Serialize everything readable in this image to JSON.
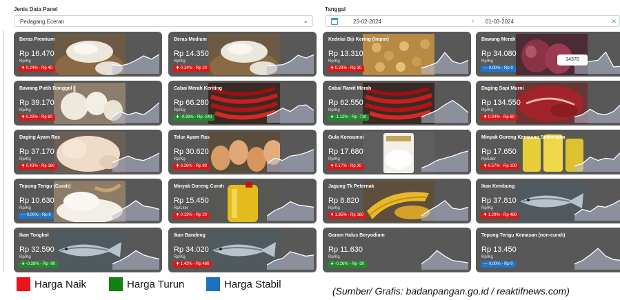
{
  "filters": {
    "panel_label": "Jenis Data Panel",
    "panel_value": "Pedagang Eceran",
    "date_label": "Tanggal",
    "date_from": "23-02-2024",
    "date_to": "01-03-2024"
  },
  "colors": {
    "card_bg": "#585858",
    "up": "#d81a1a",
    "down": "#1f8a2a",
    "flat": "#2275c7",
    "spark_fill": "#b8bdd6",
    "spark_line": "#ffffff"
  },
  "tooltip": {
    "value": "34370"
  },
  "items": [
    {
      "name": "Beras Premium",
      "price": "Rp 16.470",
      "unit": "Rp/Kg",
      "change": "0.24% - Rp 40",
      "trend": "up",
      "photo": "rice",
      "spark": [
        0.35,
        0.3,
        0.38,
        0.55,
        0.75,
        0.6,
        0.82
      ]
    },
    {
      "name": "Beras Medium",
      "price": "Rp 14.350",
      "unit": "Rp/Kg",
      "change": "0.14% - Rp 20",
      "trend": "up",
      "photo": "rice",
      "spark": [
        0.3,
        0.32,
        0.35,
        0.5,
        0.78,
        0.65,
        0.8
      ]
    },
    {
      "name": "Kedelai Biji Kering (Impor)",
      "price": "Rp 13.310",
      "unit": "Rp/Kg",
      "change": "0.23% - Rp 30",
      "trend": "up",
      "photo": "soy",
      "spark": [
        0.2,
        0.3,
        0.45,
        0.9,
        0.5,
        0.4,
        0.55
      ]
    },
    {
      "name": "Bawang Merah",
      "price": "Rp 34.080",
      "unit": "Rp/Kg",
      "change": "0.00% - Rp 0",
      "trend": "flat",
      "photo": "shallot",
      "spark": [
        0.3,
        0.4,
        0.5,
        0.55,
        0.92,
        0.25,
        0.28
      ]
    },
    {
      "name": "Bawang Putih Bonggol",
      "price": "Rp 39.170",
      "unit": "Rp/Kg",
      "change": "0.20% - Rp 80",
      "trend": "up",
      "photo": "garlic",
      "spark": [
        0.2,
        0.45,
        0.3,
        0.4,
        0.3,
        0.55,
        0.85
      ]
    },
    {
      "name": "Cabai Merah Keriting",
      "price": "Rp 66.280",
      "unit": "Rp/Kg",
      "change": "-0.36% - Rp -240",
      "trend": "down",
      "photo": "chili",
      "spark": [
        0.25,
        0.4,
        0.6,
        0.45,
        0.7,
        0.75,
        0.5
      ]
    },
    {
      "name": "Cabai Rawit Merah",
      "price": "Rp 62.550",
      "unit": "Rp/Kg",
      "change": "-1.12% - Rp -710",
      "trend": "down",
      "photo": "chili",
      "spark": [
        0.2,
        0.35,
        0.5,
        0.75,
        0.95,
        0.7,
        0.4
      ]
    },
    {
      "name": "Daging Sapi Murni",
      "price": "Rp 134.550",
      "unit": "Rp/Kg",
      "change": "0.04% - Rp 60",
      "trend": "up",
      "photo": "beef",
      "spark": [
        0.2,
        0.3,
        0.55,
        0.35,
        0.3,
        0.45,
        0.8
      ]
    },
    {
      "name": "Daging Ayam Ras",
      "price": "Rp 37.170",
      "unit": "Rp/Kg",
      "change": "0.43% - Rp 160",
      "trend": "up",
      "photo": "chicken",
      "spark": [
        0.35,
        0.5,
        0.65,
        0.5,
        0.45,
        0.6,
        0.78
      ]
    },
    {
      "name": "Telur Ayam Ras",
      "price": "Rp 30.620",
      "unit": "Rp/Kg",
      "change": "0.26% - Rp 80",
      "trend": "up",
      "photo": "egg",
      "spark": [
        0.3,
        0.55,
        0.45,
        0.65,
        0.7,
        0.8,
        0.95
      ]
    },
    {
      "name": "Gula Konsumsi",
      "price": "Rp 17.680",
      "unit": "Rp/Kg",
      "change": "0.17% - Rp 30",
      "trend": "up",
      "photo": "sugar",
      "spark": [
        0.1,
        0.25,
        0.45,
        0.55,
        0.65,
        0.78,
        0.88
      ]
    },
    {
      "name": "Minyak Goreng Kemasan Sederhana",
      "price": "Rp 17.650",
      "unit": "Rp/Liter",
      "change": "0.57% - Rp 100",
      "trend": "up",
      "photo": "oilbottle",
      "spark": [
        0.2,
        0.3,
        0.6,
        0.45,
        0.55,
        0.5,
        0.85
      ]
    },
    {
      "name": "Tepung Terigu (Curah)",
      "price": "Rp 10.630",
      "unit": "Rp/Kg",
      "change": "0.00% - Rp 0",
      "trend": "flat",
      "photo": "flour",
      "spark": [
        0.2,
        0.4,
        0.6,
        0.85,
        0.6,
        0.55,
        0.45
      ]
    },
    {
      "name": "Minyak Goreng Curah",
      "price": "Rp 15.450",
      "unit": "Rp/Liter",
      "change": "0.13% - Rp 20",
      "trend": "up",
      "photo": "oiljerry",
      "spark": [
        0.15,
        0.4,
        0.55,
        0.8,
        0.65,
        0.6,
        0.55
      ]
    },
    {
      "name": "Jagung Tk Peternak",
      "price": "Rp 8.820",
      "unit": "Rp/Kg",
      "change": "1.85% - Rp 160",
      "trend": "up",
      "photo": "corn",
      "spark": [
        0.15,
        0.4,
        0.6,
        0.85,
        0.5,
        0.45,
        0.55
      ]
    },
    {
      "name": "Ikan Kembung",
      "price": "Rp 37.810",
      "unit": "Rp/Kg",
      "change": "1.29% - Rp 480",
      "trend": "up",
      "photo": "fish",
      "spark": [
        0.2,
        0.45,
        0.35,
        0.6,
        0.55,
        0.7,
        0.9
      ]
    },
    {
      "name": "Ikan Tongkol",
      "price": "Rp 32.590",
      "unit": "Rp/Kg",
      "change": "-0.28% - Rp -90",
      "trend": "down",
      "photo": "fish",
      "spark": [
        0.2,
        0.35,
        0.55,
        0.8,
        0.6,
        0.5,
        0.42
      ]
    },
    {
      "name": "Ikan Bandeng",
      "price": "Rp 34.020",
      "unit": "Rp/Kg",
      "change": "1.43% - Rp 480",
      "trend": "up",
      "photo": "fish",
      "spark": [
        0.15,
        0.35,
        0.45,
        0.75,
        0.65,
        0.55,
        0.6
      ]
    },
    {
      "name": "Garam Halus Beryodium",
      "price": "Rp 11.630",
      "unit": "Rp/Kg",
      "change": "-0.26% - Rp -30",
      "trend": "down",
      "photo": "none",
      "spark": [
        0.2,
        0.45,
        0.8,
        0.55,
        0.35,
        0.3,
        0.25
      ]
    },
    {
      "name": "Tepung Terigu Kemasan (non-curah)",
      "price": "Rp 13.450",
      "unit": "Rp/Kg",
      "change": "0.00% - Rp 0",
      "trend": "flat",
      "photo": "none",
      "spark": [
        0.2,
        0.35,
        0.6,
        0.9,
        0.55,
        0.4,
        0.35
      ]
    }
  ],
  "legend": [
    {
      "label": "Harga Naik",
      "color": "#e8141e"
    },
    {
      "label": "Harga Turun",
      "color": "#10820f"
    },
    {
      "label": "Harga Stabil",
      "color": "#1d6fc4"
    }
  ],
  "source": "(Sumber/ Grafis: badanpangan.go.id / reaktifnews.com)"
}
